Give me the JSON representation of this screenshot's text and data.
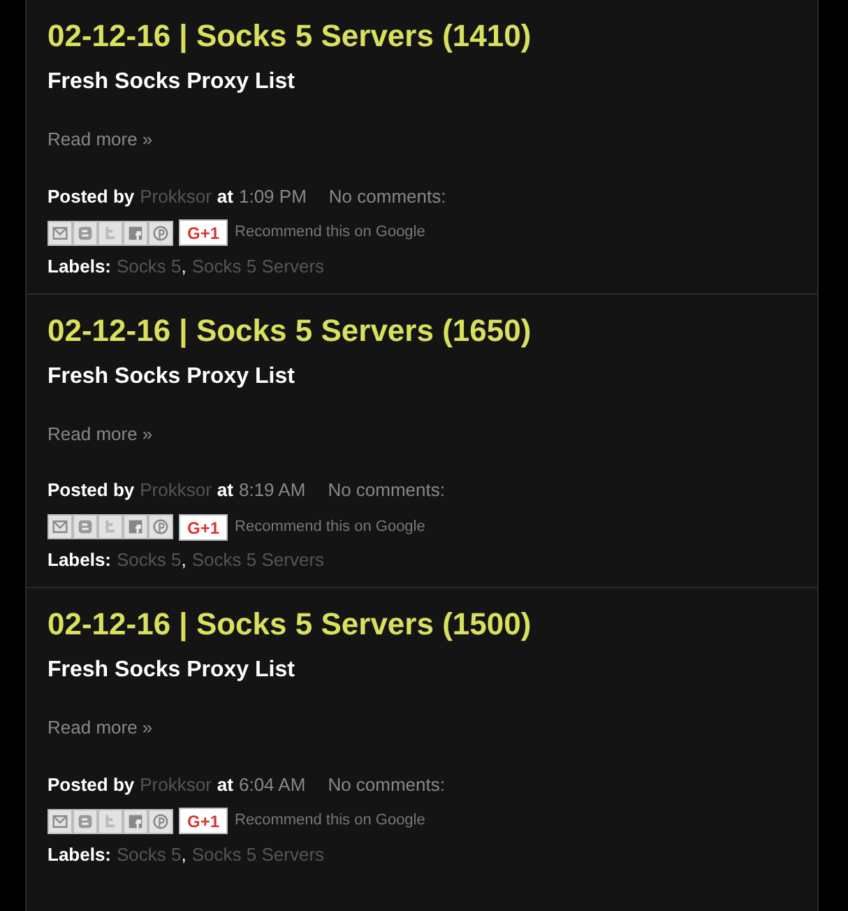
{
  "posts": [
    {
      "title": "02-12-16 | Socks 5 Servers (1410)",
      "subtitle": "Fresh Socks Proxy List",
      "read_more": "Read more »",
      "posted_by": "Posted by",
      "author": "Prokksor",
      "at": "at",
      "time": "1:09 PM",
      "comments": "No comments:",
      "recommend": "Recommend this on Google",
      "gplus": "G+1",
      "labels_caption": "Labels:",
      "labels": [
        "Socks 5",
        "Socks 5 Servers"
      ],
      "label_separator": ","
    },
    {
      "title": "02-12-16 | Socks 5 Servers (1650)",
      "subtitle": "Fresh Socks Proxy List",
      "read_more": "Read more »",
      "posted_by": "Posted by",
      "author": "Prokksor",
      "at": "at",
      "time": "8:19 AM",
      "comments": "No comments:",
      "recommend": "Recommend this on Google",
      "gplus": "G+1",
      "labels_caption": "Labels:",
      "labels": [
        "Socks 5",
        "Socks 5 Servers"
      ],
      "label_separator": ","
    },
    {
      "title": "02-12-16 | Socks 5 Servers (1500)",
      "subtitle": "Fresh Socks Proxy List",
      "read_more": "Read more »",
      "posted_by": "Posted by",
      "author": "Prokksor",
      "at": "at",
      "time": "6:04 AM",
      "comments": "No comments:",
      "recommend": "Recommend this on Google",
      "gplus": "G+1",
      "labels_caption": "Labels:",
      "labels": [
        "Socks 5",
        "Socks 5 Servers"
      ],
      "label_separator": ","
    }
  ]
}
